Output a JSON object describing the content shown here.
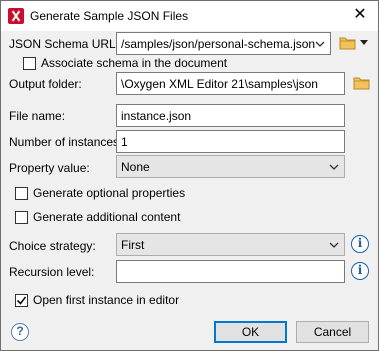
{
  "window": {
    "title": "Generate Sample JSON Files",
    "close_glyph": "✕"
  },
  "schema_url": {
    "label": "JSON Schema URL:",
    "value": "/samples/json/personal-schema.json",
    "associate_label": "Associate schema in the document",
    "associate_checked": false
  },
  "output_folder": {
    "label": "Output folder:",
    "value": "\\Oxygen XML Editor 21\\samples\\json"
  },
  "file_name": {
    "label": "File name:",
    "value": "instance.json"
  },
  "instances": {
    "label": "Number of instances:",
    "value": "1"
  },
  "property_value": {
    "label": "Property value:",
    "value": "None"
  },
  "options": {
    "optional_label": "Generate optional properties",
    "optional_checked": false,
    "additional_label": "Generate additional content",
    "additional_checked": false
  },
  "choice_strategy": {
    "label": "Choice strategy:",
    "value": "First"
  },
  "recursion": {
    "label": "Recursion level:",
    "value": ""
  },
  "open_first": {
    "label": "Open first instance in editor",
    "checked": true
  },
  "buttons": {
    "ok": "OK",
    "cancel": "Cancel",
    "help_glyph": "?"
  },
  "icons": {
    "info_glyph": "i"
  },
  "colors": {
    "accent": "#0078d7",
    "folder": "#e8b84a",
    "brand": "#c8102e"
  }
}
